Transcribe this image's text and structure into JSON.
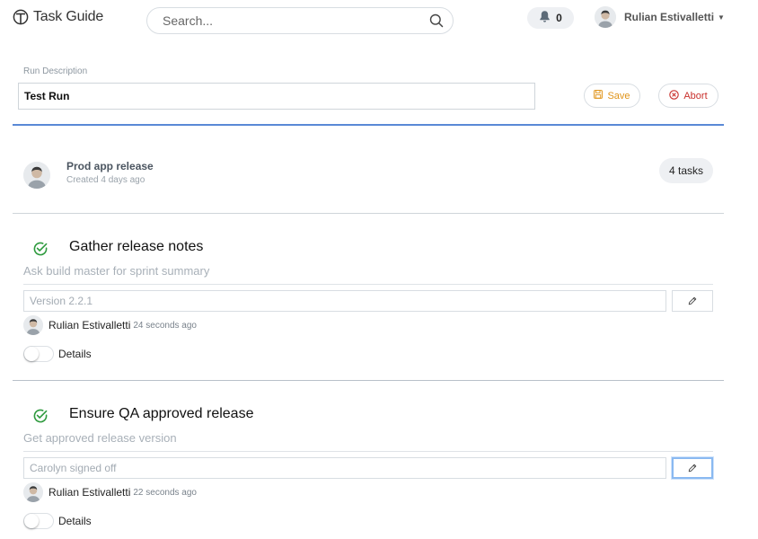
{
  "header": {
    "app_name": "Task Guide",
    "search_placeholder": "Search...",
    "notification_count": "0",
    "user_name": "Rulian Estivalletti"
  },
  "run": {
    "label": "Run Description",
    "value": "Test Run",
    "save_label": "Save",
    "abort_label": "Abort"
  },
  "checklist": {
    "title": "Prod app release",
    "created": "Created 4 days ago",
    "task_count": "4 tasks"
  },
  "tasks": [
    {
      "title": "Gather release notes",
      "subtitle": "Ask build master for sprint summary",
      "input_placeholder": "Version 2.2.1",
      "completed_by": "Rulian Estivalletti",
      "completed_ago": "24 seconds ago",
      "details_label": "Details",
      "completed": true
    },
    {
      "title": "Ensure QA approved release",
      "subtitle": "Get approved release version",
      "input_placeholder": "Carolyn signed off",
      "completed_by": "Rulian Estivalletti",
      "completed_ago": "22 seconds ago",
      "details_label": "Details",
      "completed": true
    }
  ],
  "colors": {
    "accent_blue": "#5a89d6",
    "save_orange": "#e0941a",
    "abort_red": "#c9302c",
    "check_green": "#2e9a3e"
  },
  "icons": {
    "logo": "task-guide-logo-icon",
    "search": "search-icon",
    "notification": "bell-icon",
    "save": "floppy-icon",
    "abort": "circle-x-icon",
    "task_done": "circle-check-icon",
    "edit": "pencil-icon"
  }
}
